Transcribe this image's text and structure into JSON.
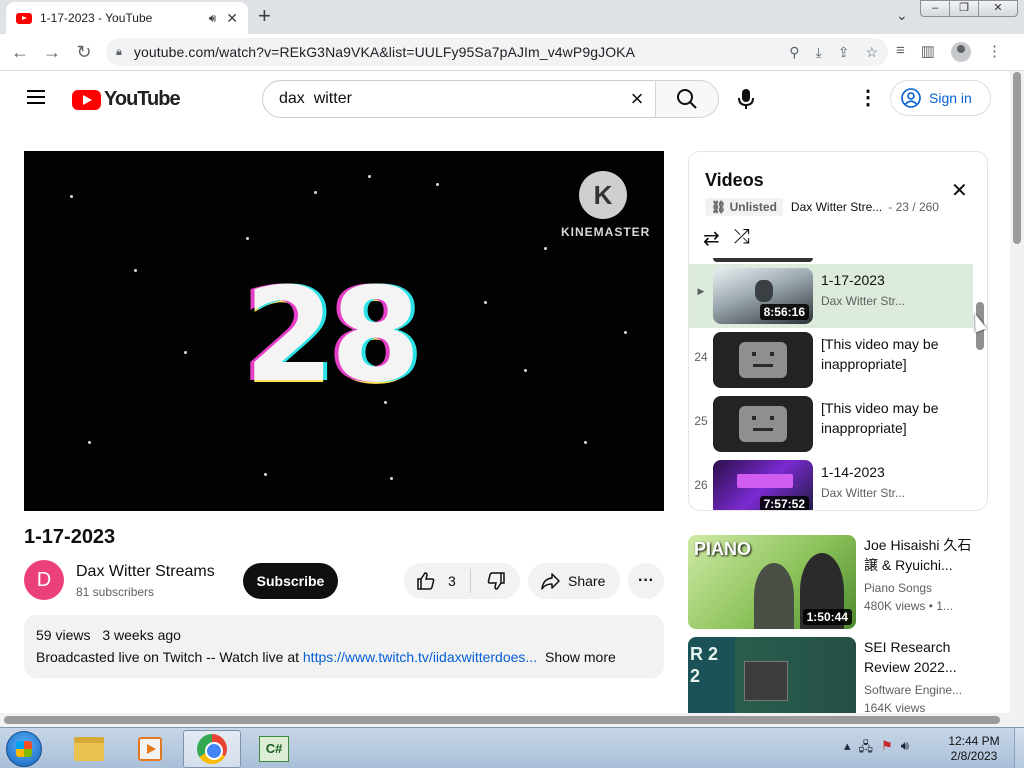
{
  "browser": {
    "tab_title": "1-17-2023 - YouTube",
    "url": "youtube.com/watch?v=REkG3Na9VKA&list=UULFy95Sa7pAJIm_v4wP9gJOKA"
  },
  "masthead": {
    "logo_text": "YouTube",
    "search_value": "dax  witter",
    "sign_in_label": "Sign in"
  },
  "player": {
    "overlay_number": "28",
    "watermark_text": "KINEMASTER"
  },
  "video": {
    "title": "1-17-2023",
    "channel_initial": "D",
    "channel_name": "Dax Witter Streams",
    "subscribers": "81 subscribers",
    "subscribe_label": "Subscribe",
    "like_count": "3",
    "share_label": "Share",
    "views": "59 views",
    "age": "3 weeks ago",
    "description_text": "Broadcasted live on Twitch -- Watch live at",
    "description_link": "https://www.twitch.tv/iidaxwitterdoes...",
    "show_more_label": "Show more"
  },
  "playlist": {
    "title": "Videos",
    "visibility": "Unlisted",
    "channel": "Dax Witter Stre...",
    "position": "- 23 / 260",
    "items": [
      {
        "num": "▶",
        "title": "1-17-2023",
        "channel": "Dax Witter Str...",
        "duration": "8:56:16",
        "active": true
      },
      {
        "num": "24",
        "title": "[This video may be inappropriate]",
        "channel": "",
        "duration": ""
      },
      {
        "num": "25",
        "title": "[This video may be inappropriate]",
        "channel": "",
        "duration": ""
      },
      {
        "num": "26",
        "title": "1-14-2023",
        "channel": "Dax Witter Str...",
        "duration": "7:57:52"
      }
    ]
  },
  "recommendations": [
    {
      "title": "Joe Hisaishi 久石 譲 & Ryuichi...",
      "channel": "Piano Songs",
      "views": "480K views  • 1...",
      "duration": "1:50:44",
      "thumb_label": "PIANO"
    },
    {
      "title": "SEI Research Review 2022...",
      "channel": "Software Engine...",
      "views": "164K views",
      "duration": "",
      "thumb_label": "R 2 2"
    }
  ],
  "taskbar": {
    "time": "12:44 PM",
    "date": "2/8/2023",
    "csharp_label": "C#"
  }
}
